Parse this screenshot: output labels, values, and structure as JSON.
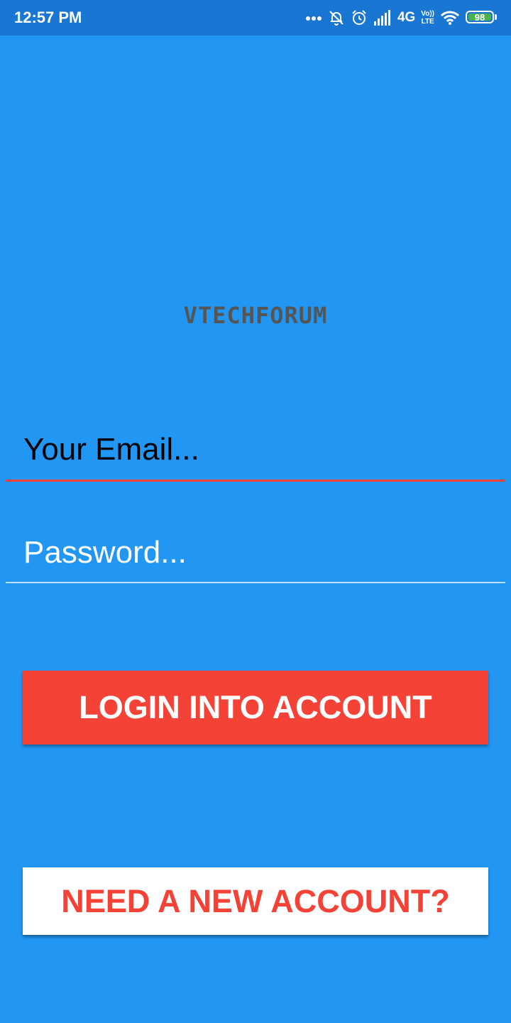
{
  "status_bar": {
    "time": "12:57 PM",
    "network": "4G",
    "volte_top": "Vo))",
    "volte_bottom": "LTE",
    "battery": "98",
    "icons": [
      "more-dots-icon",
      "notifications-off-icon",
      "alarm-icon",
      "signal-icon",
      "wifi-icon",
      "battery-icon"
    ]
  },
  "logo": {
    "text": "VTECHFORUM"
  },
  "form": {
    "email_placeholder": "Your Email...",
    "password_placeholder": "Password...",
    "login_label": "LOGIN INTO ACCOUNT",
    "register_label": "NEED A NEW ACCOUNT?"
  },
  "colors": {
    "background": "#2196F3",
    "status_bar": "#1976D2",
    "accent": "#F44336",
    "battery": "#4CAF50"
  }
}
